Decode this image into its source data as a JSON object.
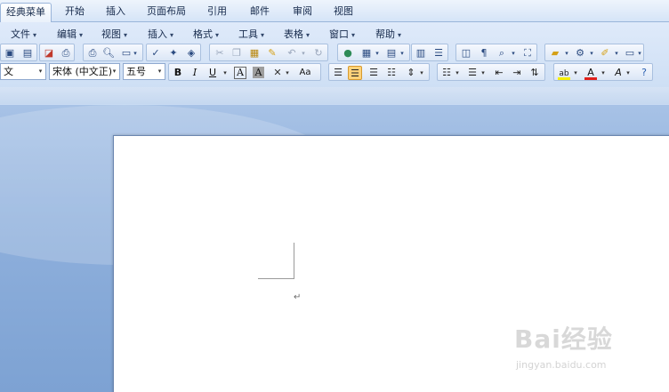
{
  "tabs": [
    {
      "label": "经典菜单",
      "active": true
    },
    {
      "label": "开始"
    },
    {
      "label": "插入"
    },
    {
      "label": "页面布局"
    },
    {
      "label": "引用"
    },
    {
      "label": "邮件"
    },
    {
      "label": "审阅"
    },
    {
      "label": "视图"
    }
  ],
  "menus": [
    "文件",
    "编辑",
    "视图",
    "插入",
    "格式",
    "工具",
    "表格",
    "窗口",
    "帮助"
  ],
  "format_bar": {
    "style_value": "文",
    "font_value": "宋体 (中文正)",
    "size_value": "五号",
    "bold": "B",
    "italic": "I",
    "underline": "U",
    "char_border": "A",
    "char_shading": "A",
    "change_case": "Aa"
  },
  "document": {
    "paragraph_mark": "↵"
  },
  "watermark": {
    "logo": "Bai经验",
    "url": "jingyan.baidu.com"
  },
  "colors": {
    "accent_highlight": "#ffd27a",
    "font_color": "#e0201b",
    "highlight_color": "#f7f000"
  }
}
